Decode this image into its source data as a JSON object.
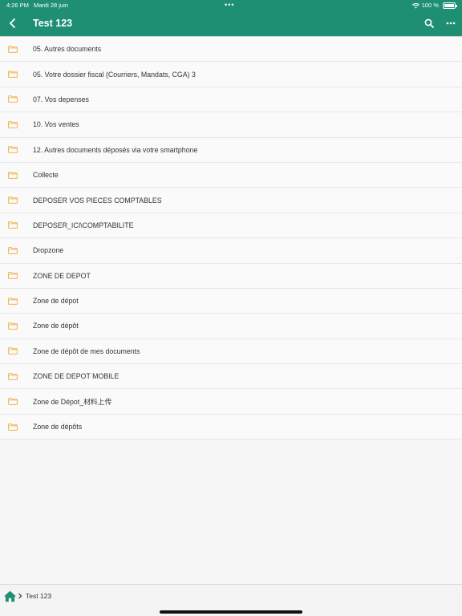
{
  "status_bar": {
    "time": "4:26 PM",
    "date": "Mardi 28 juin",
    "battery": "100 %"
  },
  "header": {
    "title": "Test 123"
  },
  "folders": [
    "05. Autres documents",
    "05. Votre dossier fiscal (Courriers, Mandats, CGA) 3",
    "07. Vos depenses",
    "10. Vos ventes",
    "12. Autres documents déposés via votre smartphone",
    "Collecte",
    "DEPOSER VOS PIECES COMPTABLES",
    "DEPOSER_ICI\\COMPTABILITE",
    "Dropzone",
    "ZONE DE DEPOT",
    "Zone de dépot",
    "Zone de dépôt",
    "Zone de dépôt de mes documents",
    "ZONE DE DEPOT MOBILE",
    "Zone de Dépot_材料上传",
    "Zone de dépôts"
  ],
  "breadcrumb": {
    "current": "Test 123"
  },
  "colors": {
    "header": "#1f8f73",
    "folder": "#f0b44c",
    "home": "#1f8f73"
  }
}
